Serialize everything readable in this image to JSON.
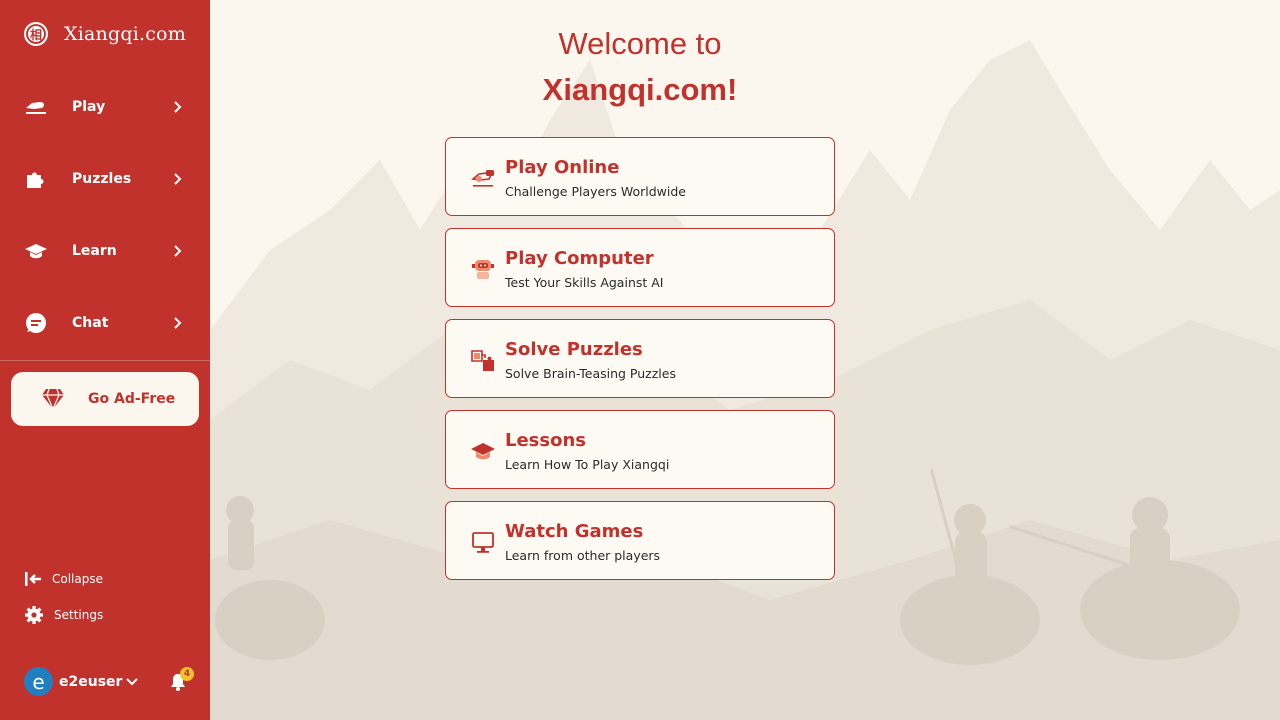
{
  "brand": {
    "logo_glyph": "相",
    "name": "Xiangqi.com"
  },
  "colors": {
    "primary": "#c2322d",
    "background": "#fbf7ef",
    "avatar": "#1f7fc1",
    "badge": "#f2c12e"
  },
  "sidebar": {
    "nav": [
      {
        "label": "Play",
        "icon": "pawn-hand-icon"
      },
      {
        "label": "Puzzles",
        "icon": "puzzle-icon"
      },
      {
        "label": "Learn",
        "icon": "graduation-cap-icon"
      },
      {
        "label": "Chat",
        "icon": "chat-bubble-icon"
      }
    ],
    "ad_free_label": "Go Ad-Free",
    "collapse_label": "Collapse",
    "settings_label": "Settings",
    "user": {
      "avatar_letter": "e",
      "username": "e2euser"
    },
    "notifications_count": "4"
  },
  "main": {
    "welcome_line1": "Welcome to",
    "welcome_line2": "Xiangqi.com!",
    "cards": [
      {
        "title": "Play Online",
        "subtitle": "Challenge Players Worldwide",
        "icon": "play-online-icon"
      },
      {
        "title": "Play Computer",
        "subtitle": "Test Your Skills Against AI",
        "icon": "robot-icon"
      },
      {
        "title": "Solve Puzzles",
        "subtitle": "Solve Brain-Teasing Puzzles",
        "icon": "puzzle-icon"
      },
      {
        "title": "Lessons",
        "subtitle": "Learn How To Play Xiangqi",
        "icon": "graduation-cap-icon"
      },
      {
        "title": "Watch Games",
        "subtitle": "Learn from other players",
        "icon": "monitor-icon"
      }
    ]
  }
}
